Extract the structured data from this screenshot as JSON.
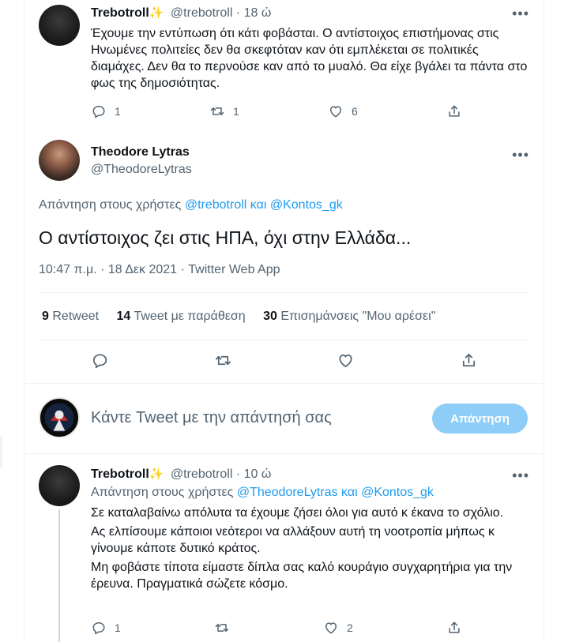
{
  "tweet1": {
    "name": "Trebotroll",
    "emoji": "✨",
    "handle": "@trebotroll",
    "time": "· 18 ώ",
    "text": "Έχουμε την εντύπωση ότι κάτι φοβάσται. Ο αντίστοιχος επιστήμονας στις Ηνωμένες πολιτείες δεν θα σκεφτόταν καν ότι εμπλέκεται σε πολιτικές διαμάχες. Δεν θα το περνούσε καν από το μυαλό. Θα είχε βγάλει τα πάντα στο φως της δημοσιότητας.",
    "replies": "1",
    "retweets": "1",
    "likes": "6"
  },
  "main": {
    "name": "Theodore Lytras",
    "handle": "@TheodoreLytras",
    "reply_prefix": "Απάντηση στους χρήστες",
    "reply_user1": "@trebotroll",
    "reply_and": "και",
    "reply_user2": "@Kontos_gk",
    "text": "Ο αντίστοιχος ζει στις ΗΠΑ, όχι στην Ελλάδα...",
    "meta": "10:47 π.μ. · 18 Δεκ 2021 · Twitter Web App",
    "stats": {
      "retweets_count": "9",
      "retweets_label": "Retweet",
      "quotes_count": "14",
      "quotes_label": "Tweet με παράθεση",
      "likes_count": "30",
      "likes_label": "Επισημάνσεις \"Μου αρέσει\""
    }
  },
  "compose": {
    "placeholder": "Κάντε Tweet με την απάντησή σας",
    "button": "Απάντηση"
  },
  "tweet3": {
    "name": "Trebotroll",
    "emoji": "✨",
    "handle": "@trebotroll",
    "time": "· 10 ώ",
    "reply_prefix": "Απάντηση στους χρήστες",
    "reply_user1": "@TheodoreLytras",
    "reply_and": "και",
    "reply_user2": "@Kontos_gk",
    "line1": "Σε καταλαβαίνω απόλυτα τα έχουμε ζήσει όλοι για αυτό κ έκανα το σχόλιο.",
    "line2": "Ας ελπίσουμε κάποιοι νεότεροι να αλλάξουν αυτή τη νοοτροπία μήπως κ γίνουμε κάποτε δυτικό κράτος.",
    "line3": "Μη φοβάστε τίποτα είμαστε δίπλα σας καλό κουράγιο συγχαρητήρια για την έρευνα. Πραγματικά σώζετε κόσμο.",
    "replies": "1",
    "likes": "2"
  },
  "icons": {
    "more": "more-icon",
    "reply": "reply-icon",
    "retweet": "retweet-icon",
    "like": "heart-icon",
    "share": "share-icon"
  },
  "colors": {
    "accent": "#1d9bf0",
    "button_disabled": "#8ecdf8",
    "muted": "#536471"
  }
}
